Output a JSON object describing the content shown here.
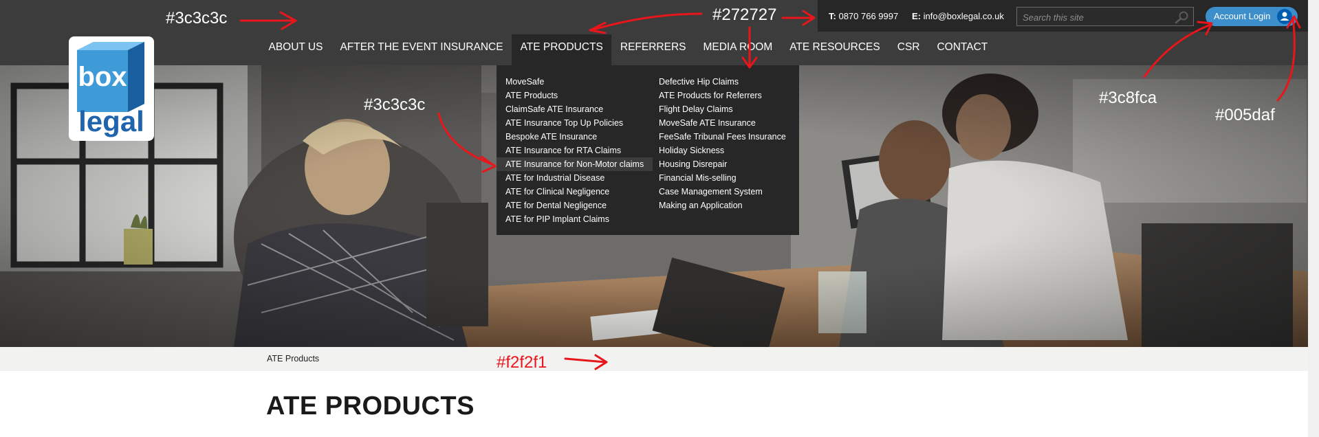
{
  "header": {
    "phone_label": "T:",
    "phone": "0870 766 9997",
    "email_label": "E:",
    "email": "info@boxlegal.co.uk",
    "search_placeholder": "Search this site",
    "login_label": "Account Login",
    "logo": {
      "line1": "box",
      "line2": "legal"
    },
    "search_icon": "search-icon",
    "user_icon": "user-icon"
  },
  "nav": {
    "items": [
      "ABOUT US",
      "AFTER THE EVENT INSURANCE",
      "ATE PRODUCTS",
      "REFERRERS",
      "MEDIA ROOM",
      "ATE RESOURCES",
      "CSR",
      "CONTACT"
    ],
    "active": "ATE PRODUCTS"
  },
  "dropdown": {
    "col1": [
      "MoveSafe",
      "ATE Products",
      "ClaimSafe ATE Insurance",
      "ATE Insurance Top Up Policies",
      "Bespoke ATE Insurance",
      "ATE Insurance for RTA Claims",
      "ATE Insurance for Non-Motor claims",
      "ATE for Industrial Disease",
      "ATE for Clinical Negligence",
      "ATE for Dental Negligence",
      "ATE for PIP Implant Claims"
    ],
    "col2": [
      "Defective Hip Claims",
      "ATE Products for Referrers",
      "Flight Delay Claims",
      "MoveSafe ATE Insurance",
      "FeeSafe Tribunal Fees Insurance",
      "Holiday Sickness",
      "Housing Disrepair",
      "Financial Mis-selling",
      "Case Management System",
      "Making an Application"
    ],
    "highlighted": "ATE Insurance for Non-Motor claims"
  },
  "breadcrumb": "ATE Products",
  "page_title": "ATE PRODUCTS",
  "annotations": {
    "a1": "#3c3c3c",
    "a2": "#272727",
    "a3": "#3c3c3c",
    "a4": "#3c8fca",
    "a5": "#005daf",
    "a6": "#f2f2f1"
  },
  "colors": {
    "header_bg": "#3c3c3c",
    "dark_bg": "#272727",
    "login_bg": "#3c8fca",
    "login_icon_bg": "#005daf",
    "breadcrumb_bg": "#f2f2f1",
    "logo_blue": "#1f64ac",
    "annotation_red": "#e8161b"
  }
}
